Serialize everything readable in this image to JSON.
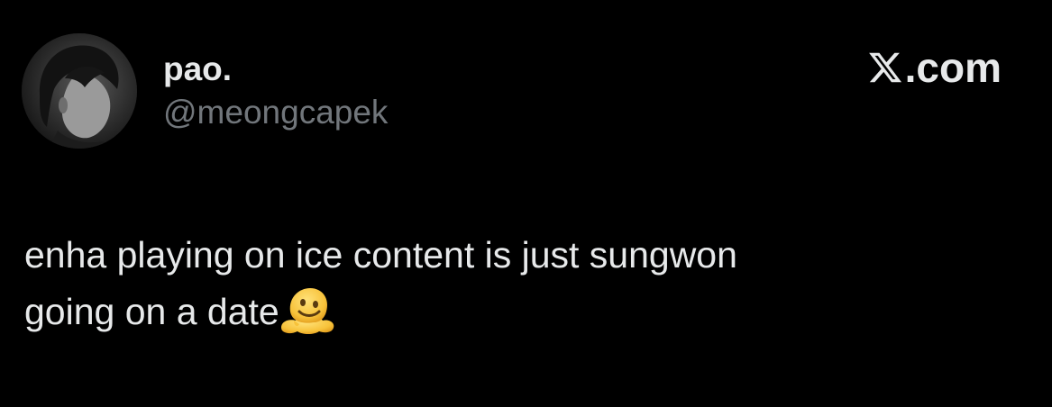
{
  "author": {
    "display_name": "pao.",
    "handle": "@meongcapek"
  },
  "brand": {
    "text": ".com",
    "icon": "x-logo-icon"
  },
  "tweet": {
    "line1": "enha playing on ice content is just sungwon",
    "line2": "going on a date",
    "emoji": "melting-face-icon"
  },
  "colors": {
    "background": "#000000",
    "primary_text": "#e7e9ea",
    "secondary_text": "#71767b",
    "emoji_yellow": "#f7c23a"
  }
}
